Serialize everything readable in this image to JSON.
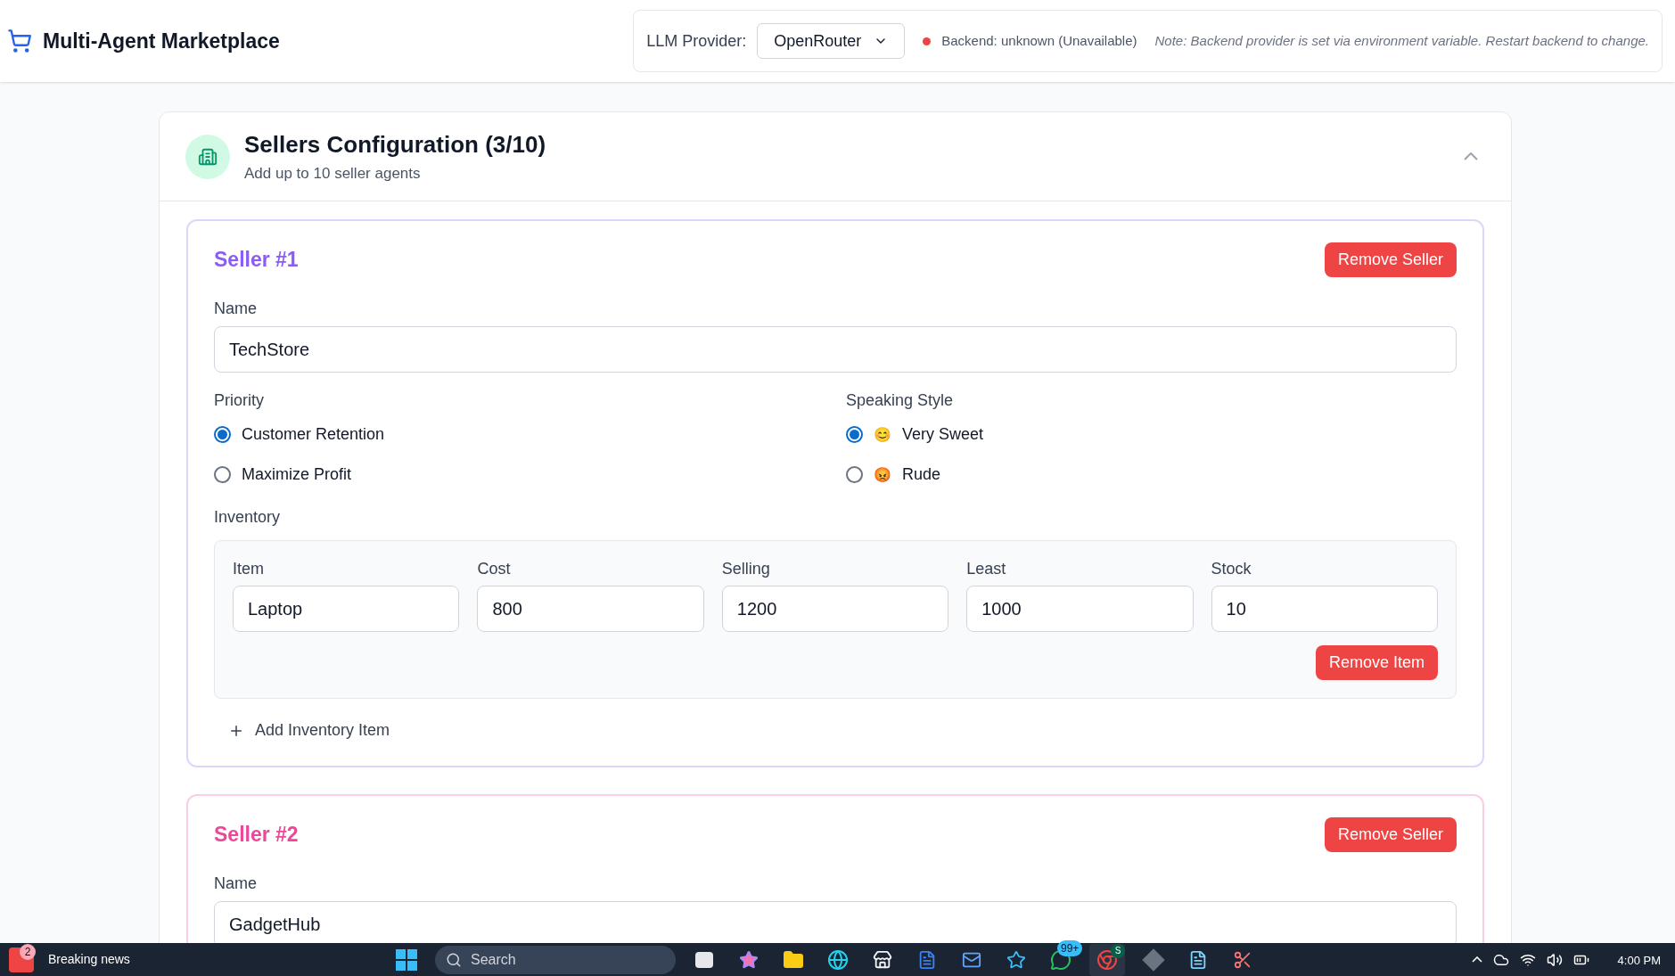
{
  "header": {
    "title": "Multi-Agent Marketplace"
  },
  "provider": {
    "label": "LLM Provider:",
    "value": "OpenRouter",
    "backend_available": false,
    "backend_text": "Backend: unknown (Unavailable)",
    "note": "Note: Backend provider is set via environment variable. Restart backend to change."
  },
  "section": {
    "title": "Sellers Configuration (3/10)",
    "subtitle": "Add up to 10 seller agents",
    "expanded": true
  },
  "sellers": [
    {
      "heading": "Seller #1",
      "color": "#8b5cf6",
      "remove_label": "Remove Seller",
      "name_label": "Name",
      "name_value": "TechStore",
      "priority_label": "Priority",
      "priority_options": [
        {
          "label": "Customer Retention",
          "selected": true
        },
        {
          "label": "Maximize Profit",
          "selected": false
        }
      ],
      "style_label": "Speaking Style",
      "style_options": [
        {
          "emoji": "😊",
          "label": "Very Sweet",
          "selected": true
        },
        {
          "emoji": "😡",
          "label": "Rude",
          "selected": false
        }
      ],
      "inventory_label": "Inventory",
      "inventory": [
        {
          "fields": [
            {
              "label": "Item",
              "value": "Laptop"
            },
            {
              "label": "Cost",
              "value": "800"
            },
            {
              "label": "Selling",
              "value": "1200"
            },
            {
              "label": "Least",
              "value": "1000"
            },
            {
              "label": "Stock",
              "value": "10"
            }
          ],
          "remove_label": "Remove Item"
        }
      ],
      "add_label": "Add Inventory Item"
    },
    {
      "heading": "Seller #2",
      "color": "#ec4899",
      "remove_label": "Remove Seller",
      "name_label": "Name",
      "name_value": "GadgetHub"
    }
  ],
  "taskbar": {
    "news_count": "2",
    "news_title": "Breaking news",
    "search_placeholder": "Search",
    "chat_badge": "99+",
    "profile_letter": "S",
    "time": "4:00 PM"
  }
}
